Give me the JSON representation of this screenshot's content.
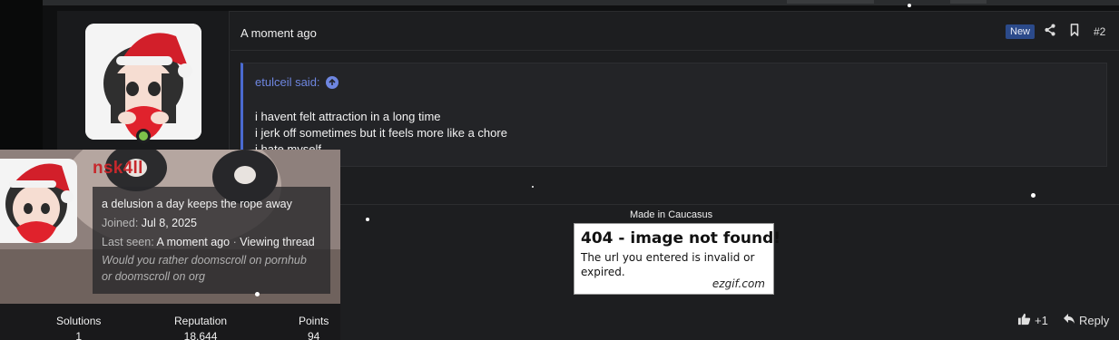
{
  "post": {
    "time": "A moment ago",
    "badge": "New",
    "number": "#2",
    "quote": {
      "author": "etulceil said:",
      "lines": [
        "i havent felt attraction in a long time",
        "i jerk off sometimes but it feels more like a chore",
        "i hate myself"
      ]
    },
    "signature": {
      "caption": "Made in Caucasus",
      "image": {
        "title": "404 - image not found!",
        "message": "The url you entered is invalid or expired.",
        "brand": "ezgif.com"
      }
    },
    "reactions": {
      "count": "+1",
      "reply_label": "Reply"
    }
  },
  "member_card": {
    "username": "nsk4ll",
    "user_title": "a delusion a day keeps the rope away",
    "joined_label": "Joined:",
    "joined_value": "Jul 8, 2025",
    "last_seen_label": "Last seen:",
    "last_seen_value": "A moment ago",
    "activity": "Viewing thread",
    "signature_text_1": "Would you rather ",
    "signature_link_1": "doomscroll on pornhub",
    "signature_text_2": "or ",
    "signature_link_2": "doomscroll on org",
    "stats": [
      {
        "label": "Solutions",
        "value": "1"
      },
      {
        "label": "Reputation",
        "value": "18,644"
      },
      {
        "label": "Points",
        "value": "94"
      }
    ]
  },
  "icons": {
    "share": "share-icon",
    "bookmark": "bookmark-icon",
    "quote_up": "arrow-up-circle-icon",
    "like": "thumbs-up-icon",
    "reply": "reply-icon"
  },
  "colors": {
    "username": "#c7282c",
    "quote_accent": "#4a6ad0",
    "badge_new": "#2b4a8a",
    "online": "#7cc24a"
  }
}
